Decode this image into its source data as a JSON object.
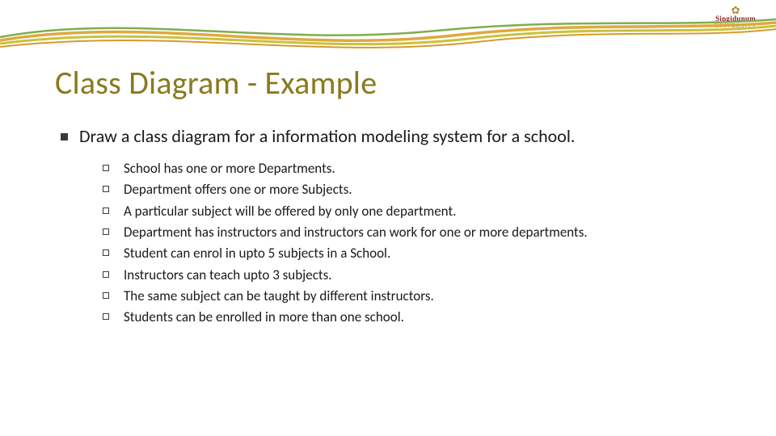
{
  "logo": {
    "mark": "✿",
    "name": "Singidunum",
    "sub": "UNIVERSITY"
  },
  "title": "Class Diagram - Example",
  "lead": "Draw a class diagram for a information modeling system for a school.",
  "items": [
    "School has one or more Departments.",
    "Department offers one or more Subjects.",
    "A particular subject will be offered by only one department.",
    "Department has instructors and instructors can work for one or more departments.",
    "Student can enrol in upto 5 subjects in a School.",
    "Instructors can teach upto 3 subjects.",
    "The same subject can be taught by different instructors.",
    "Students can be enrolled in more than one school."
  ]
}
